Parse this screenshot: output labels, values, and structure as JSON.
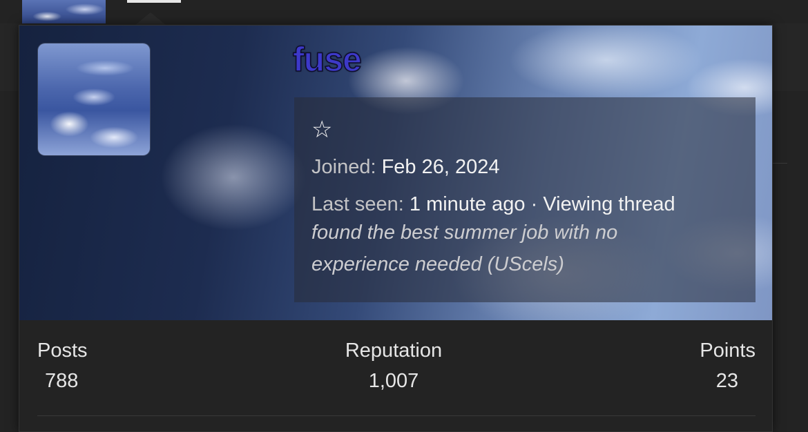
{
  "profile": {
    "username": "fuse",
    "star": "☆",
    "joined_label": "Joined:",
    "joined_value": "Feb 26, 2024",
    "last_seen_label": "Last seen:",
    "last_seen_value": "1 minute ago · Viewing thread",
    "thread_title": "found the best summer job with no experience needed (UScels)"
  },
  "stats": [
    {
      "label": "Posts",
      "value": "788"
    },
    {
      "label": "Reputation",
      "value": "1,007"
    },
    {
      "label": "Points",
      "value": "23"
    }
  ],
  "colors": {
    "username": "#3d39c9",
    "background": "#232323",
    "text": "#e6e6e6"
  }
}
